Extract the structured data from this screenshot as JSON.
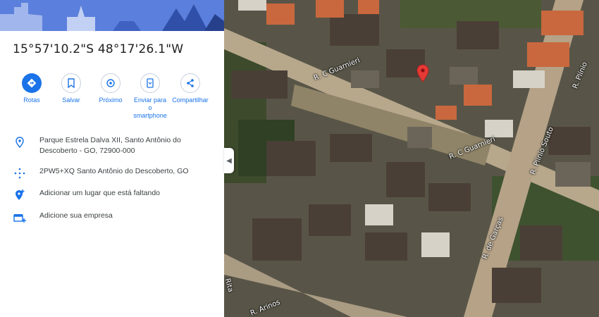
{
  "place": {
    "coordinates": "15°57'10.2\"S 48°17'26.1\"W"
  },
  "actions": [
    {
      "label": "Rotas",
      "icon": "directions-icon"
    },
    {
      "label": "Salvar",
      "icon": "bookmark-icon"
    },
    {
      "label": "Próximo",
      "icon": "nearby-icon"
    },
    {
      "label": "Enviar para o smartphone",
      "icon": "send-to-phone-icon"
    },
    {
      "label": "Compartilhar",
      "icon": "share-icon"
    }
  ],
  "info": {
    "address": "Parque Estrela Dalva XII, Santo Antônio do Descoberto - GO, 72900-000",
    "plus_code": "2PW5+XQ Santo Antônio do Descoberto, GO",
    "add_place": "Adicionar um lugar que está faltando",
    "add_business": "Adicione sua empresa"
  },
  "map": {
    "streets": {
      "s1": "R. C Guarnieri",
      "s2": "R. C Guarnieri",
      "s3": "R. Plínio Souto",
      "s4": "R. de Garças",
      "s5": "Rita",
      "s6": "R. Arinos",
      "s7": "R. Plínio"
    },
    "pin_color": "#e53935"
  },
  "colors": {
    "accent": "#1a73e8"
  }
}
